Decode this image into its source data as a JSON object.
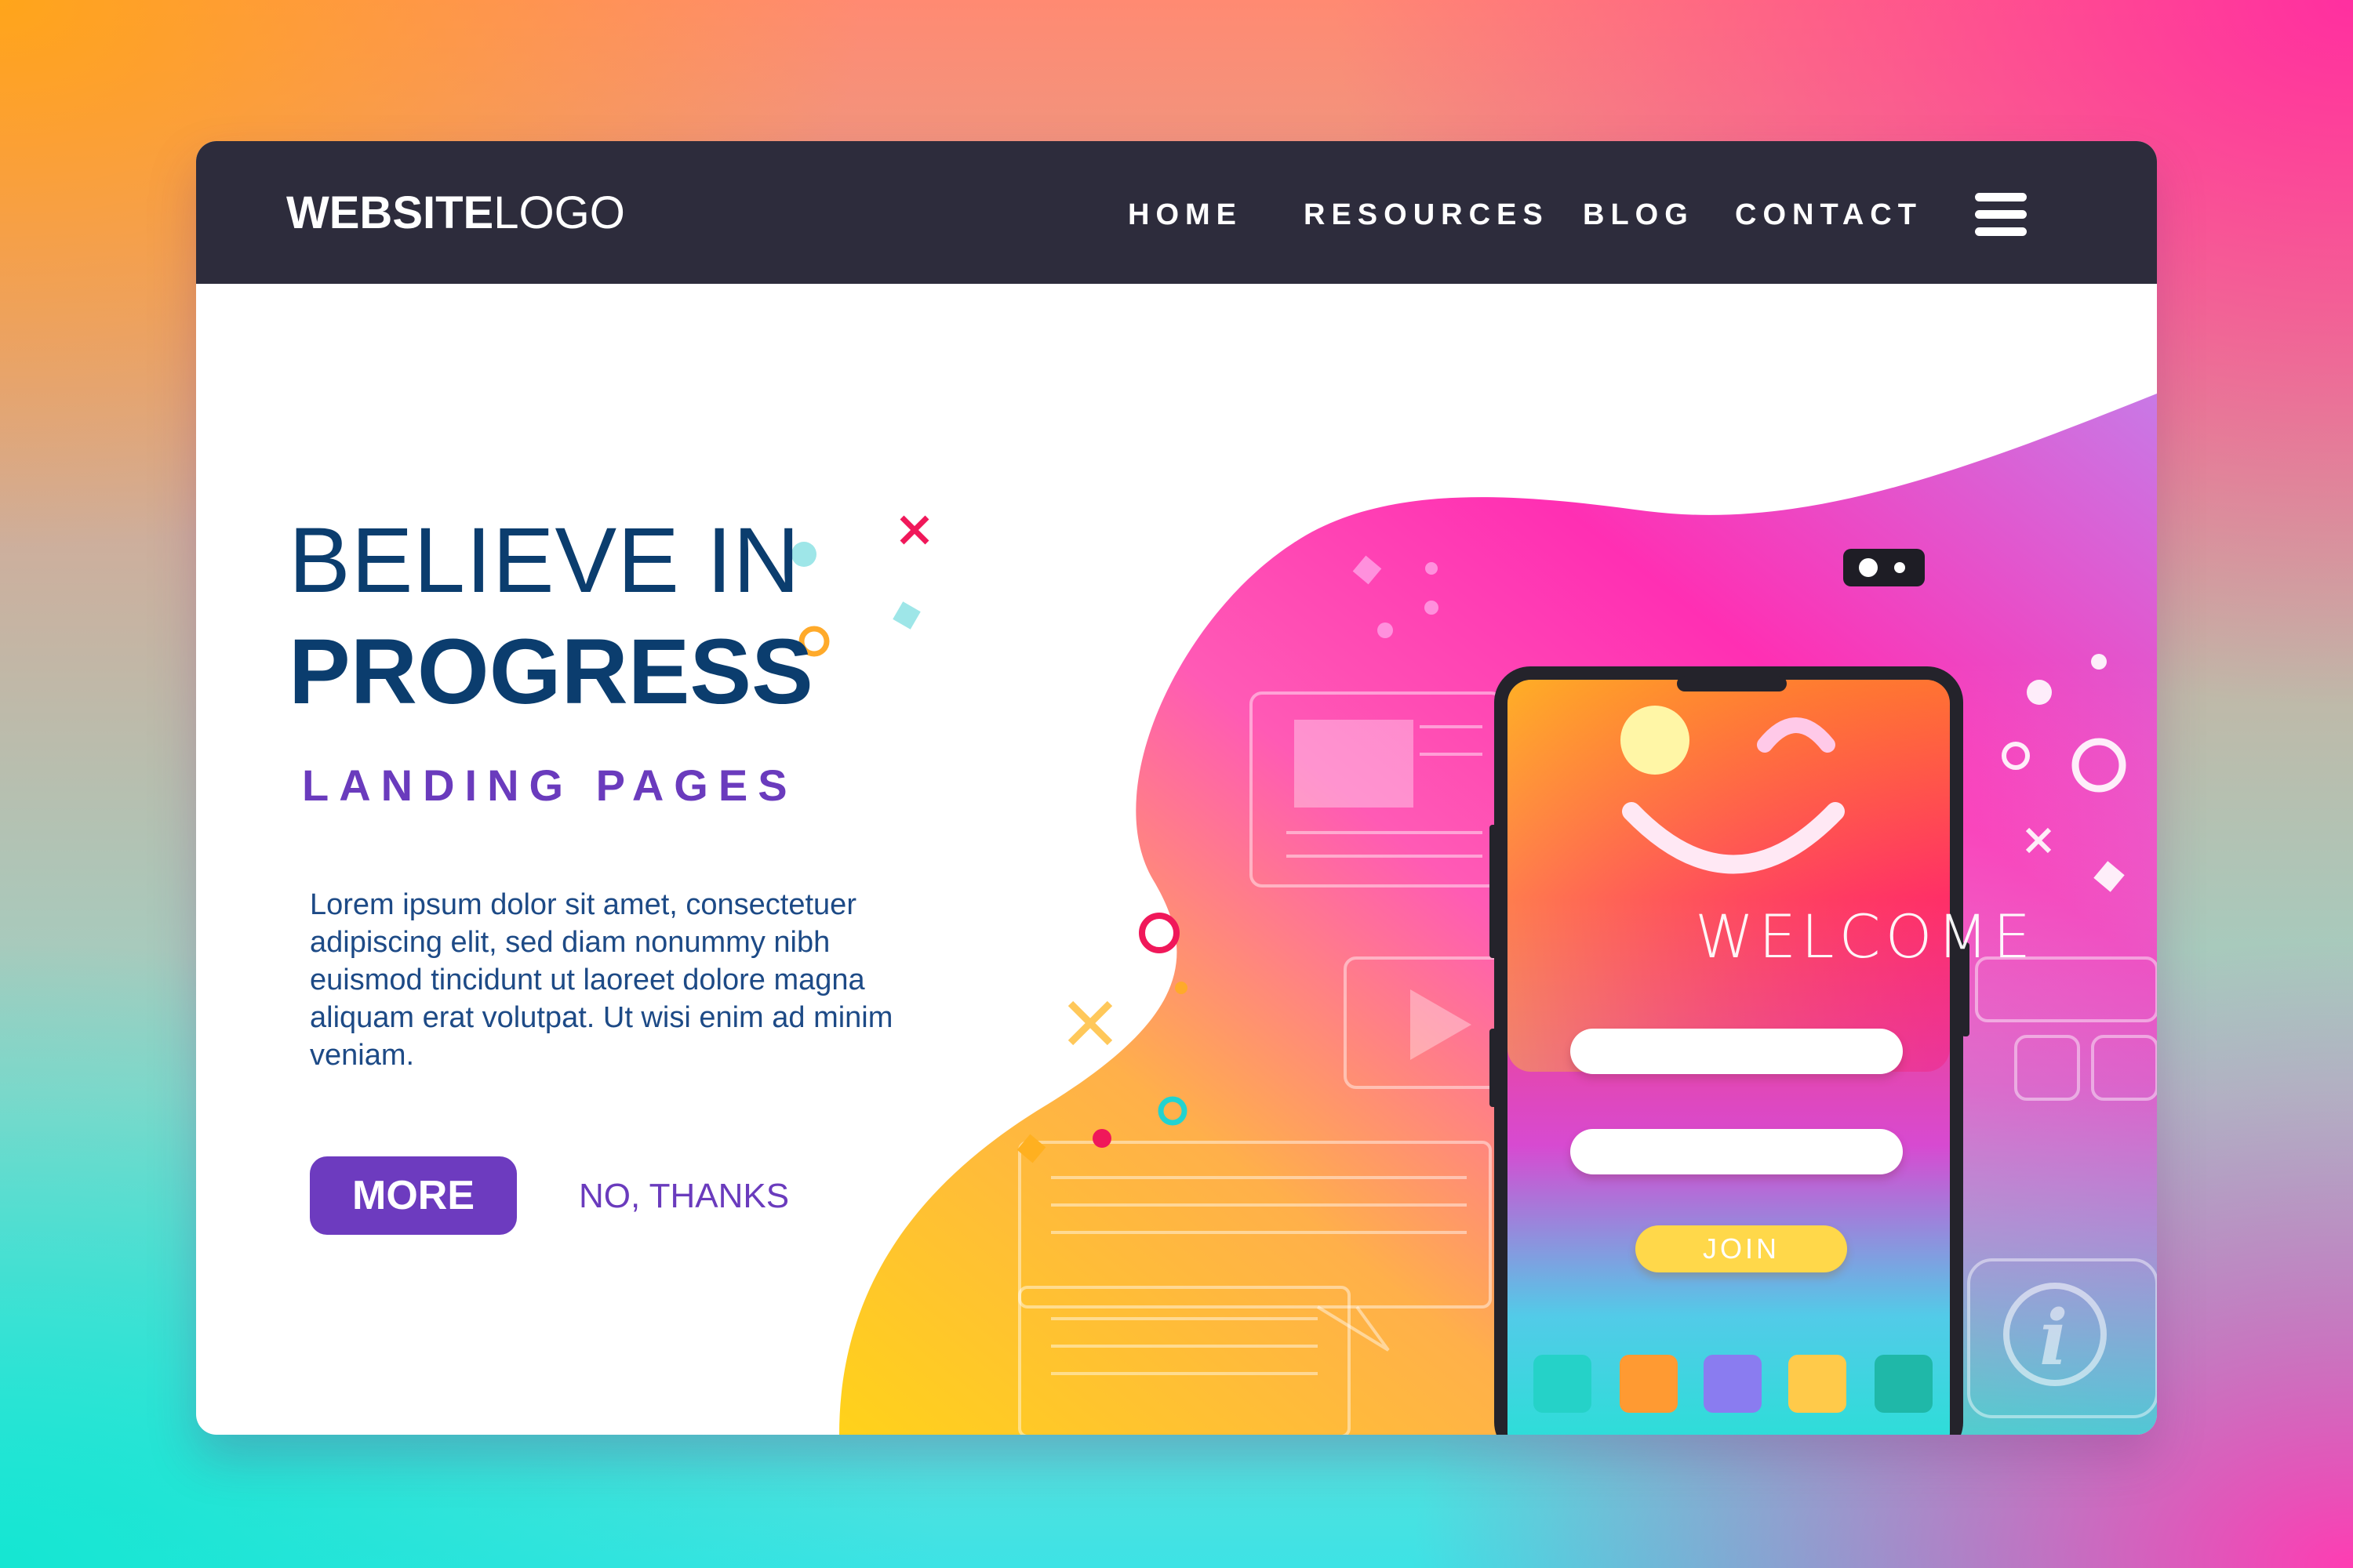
{
  "header": {
    "logo_bold": "WEBSITE",
    "logo_light": "LOGO",
    "nav": [
      "HOME",
      "RESOURCES",
      "BLOG",
      "CONTACT"
    ],
    "menu_icon": "hamburger-menu-icon",
    "background_color": "#2d2c3c"
  },
  "hero": {
    "headline_line1": "BELIEVE IN",
    "headline_line2": "PROGRESS",
    "subheading": "LANDING PAGES",
    "body": "Lorem ipsum dolor sit amet, consectetuer adipiscing elit, sed diam nonummy nibh euismod tincidunt ut laoreet dolore magna aliquam erat volutpat. Ut wisi enim ad minim veniam.",
    "primary_button": "MORE",
    "secondary_link": "NO, THANKS"
  },
  "phone": {
    "welcome": "WELCOME",
    "join_button": "JOIN",
    "icons": [
      "smiley-wink-icon",
      "camera-icon",
      "app-icon-teal",
      "app-icon-orange",
      "app-icon-purple",
      "app-icon-yellow",
      "app-icon-green"
    ]
  },
  "colors": {
    "navy_text": "#0b3d6e",
    "purple_accent": "#6d3bbf",
    "pink": "#ff2fa0",
    "orange": "#ffa51a",
    "teal": "#15e6d2"
  }
}
